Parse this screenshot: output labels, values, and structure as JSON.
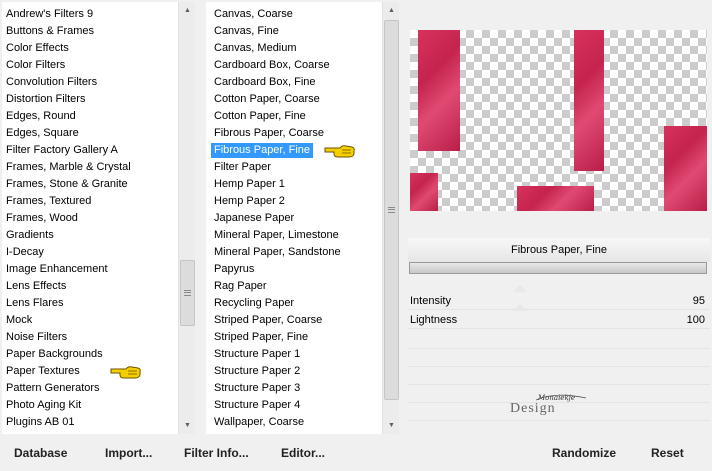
{
  "categories": {
    "items": [
      "Andrew's Filters 9",
      "Buttons & Frames",
      "Color Effects",
      "Color Filters",
      "Convolution Filters",
      "Distortion Filters",
      "Edges, Round",
      "Edges, Square",
      "Filter Factory Gallery A",
      "Frames, Marble & Crystal",
      "Frames, Stone & Granite",
      "Frames, Textured",
      "Frames, Wood",
      "Gradients",
      "I-Decay",
      "Image Enhancement",
      "Lens Effects",
      "Lens Flares",
      "Mock",
      "Noise Filters",
      "Paper Backgrounds",
      "Paper Textures",
      "Pattern Generators",
      "Photo Aging Kit",
      "Plugins AB 01"
    ],
    "pointer_index": 21
  },
  "filters": {
    "items": [
      "Canvas, Coarse",
      "Canvas, Fine",
      "Canvas, Medium",
      "Cardboard Box, Coarse",
      "Cardboard Box, Fine",
      "Cotton Paper, Coarse",
      "Cotton Paper, Fine",
      "Fibrous Paper, Coarse",
      "Fibrous Paper, Fine",
      "Filter Paper",
      "Hemp Paper 1",
      "Hemp Paper 2",
      "Japanese Paper",
      "Mineral Paper, Limestone",
      "Mineral Paper, Sandstone",
      "Papyrus",
      "Rag Paper",
      "Recycling Paper",
      "Striped Paper, Coarse",
      "Striped Paper, Fine",
      "Structure Paper 1",
      "Structure Paper 2",
      "Structure Paper 3",
      "Structure Paper 4",
      "Wallpaper, Coarse"
    ],
    "selected_index": 8
  },
  "preview": {
    "filter_name": "Fibrous Paper, Fine",
    "strip_color": "#d02a58"
  },
  "parameters": [
    {
      "label": "Intensity",
      "value": "95"
    },
    {
      "label": "Lightness",
      "value": "100"
    }
  ],
  "logo": {
    "text": "Design",
    "signature": "Monaiekje"
  },
  "buttons": {
    "database": "Database",
    "import": "Import...",
    "filter_info": "Filter Info...",
    "editor": "Editor...",
    "randomize": "Randomize",
    "reset": "Reset"
  },
  "colors": {
    "selection": "#3399ff",
    "pointer": "#f5d000"
  }
}
